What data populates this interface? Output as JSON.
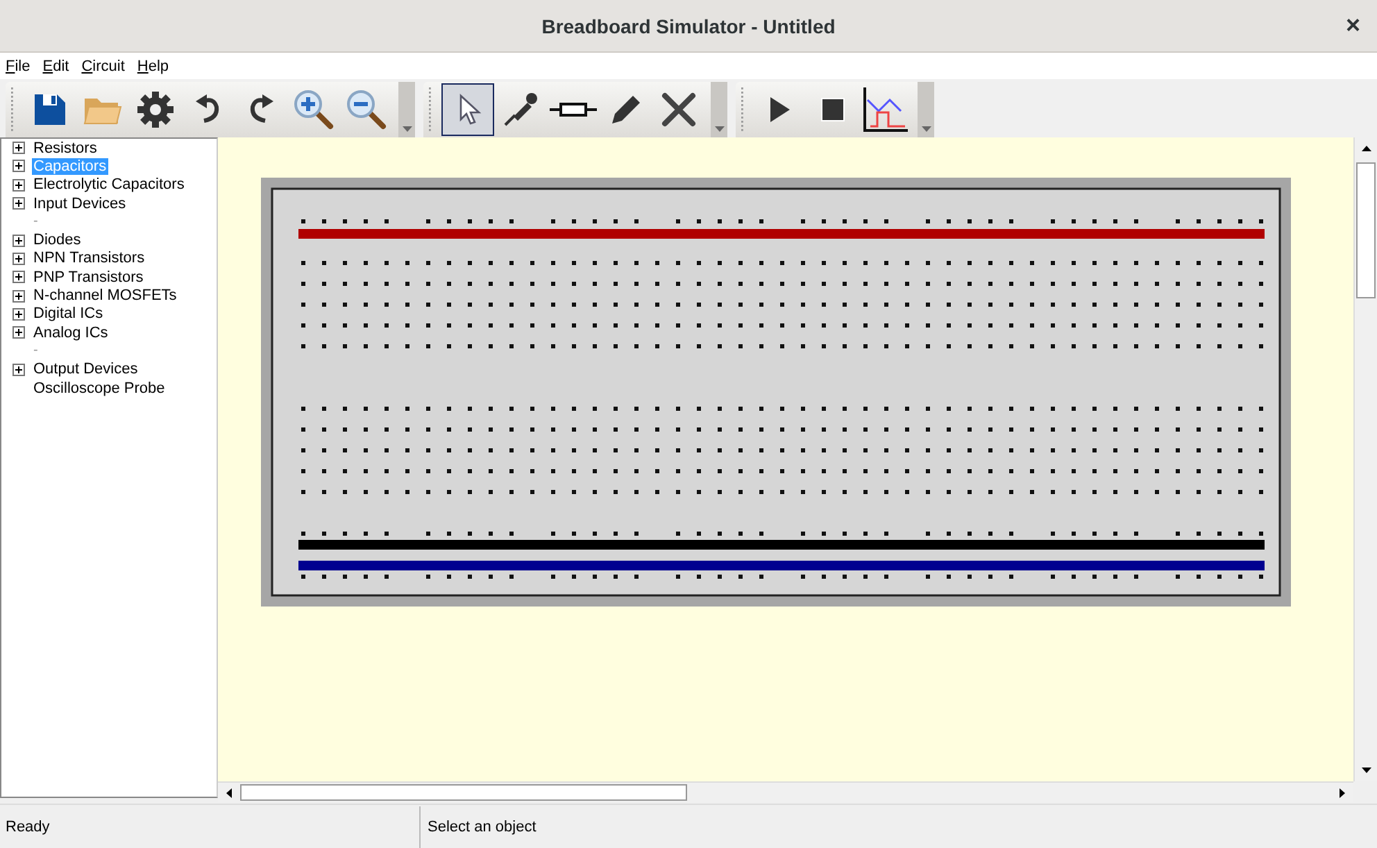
{
  "window": {
    "title": "Breadboard Simulator - Untitled",
    "close": "×"
  },
  "menu": [
    {
      "label": "File"
    },
    {
      "label": "Edit"
    },
    {
      "label": "Circuit"
    },
    {
      "label": "Help"
    }
  ],
  "toolbars": [
    {
      "buttons": [
        {
          "kind": "save",
          "selected": false
        },
        {
          "kind": "open",
          "selected": false
        },
        {
          "kind": "settings",
          "selected": false
        },
        {
          "kind": "undo",
          "selected": false
        },
        {
          "kind": "redo",
          "selected": false
        },
        {
          "kind": "zoom-in",
          "selected": false
        },
        {
          "kind": "zoom-out",
          "selected": false
        }
      ]
    },
    {
      "buttons": [
        {
          "kind": "pointer",
          "selected": true
        },
        {
          "kind": "probe",
          "selected": false
        },
        {
          "kind": "resistor",
          "selected": false
        },
        {
          "kind": "pencil",
          "selected": false
        },
        {
          "kind": "cross",
          "selected": false
        }
      ]
    },
    {
      "buttons": [
        {
          "kind": "play",
          "selected": false
        },
        {
          "kind": "stop",
          "selected": false
        },
        {
          "kind": "graph",
          "selected": false
        }
      ]
    }
  ],
  "sidebar": {
    "items": [
      {
        "label": "Resistors",
        "kind": "group",
        "selected": false
      },
      {
        "label": "Capacitors",
        "kind": "group",
        "selected": true
      },
      {
        "label": "Electrolytic Capacitors",
        "kind": "group",
        "selected": false
      },
      {
        "label": "Input Devices",
        "kind": "group",
        "selected": false
      },
      {
        "label": "-",
        "kind": "separator",
        "selected": false
      },
      {
        "label": "Diodes",
        "kind": "group",
        "selected": false
      },
      {
        "label": "NPN Transistors",
        "kind": "group",
        "selected": false
      },
      {
        "label": "PNP Transistors",
        "kind": "group",
        "selected": false
      },
      {
        "label": "N-channel MOSFETs",
        "kind": "group",
        "selected": false
      },
      {
        "label": "Digital ICs",
        "kind": "group",
        "selected": false
      },
      {
        "label": "Analog ICs",
        "kind": "group",
        "selected": false
      },
      {
        "label": "-",
        "kind": "separator",
        "selected": false
      },
      {
        "label": "Output Devices",
        "kind": "group",
        "selected": false
      },
      {
        "label": "Oscilloscope Probe",
        "kind": "leaf",
        "selected": false
      }
    ]
  },
  "status_bar": [
    "Ready",
    "Select an object"
  ]
}
